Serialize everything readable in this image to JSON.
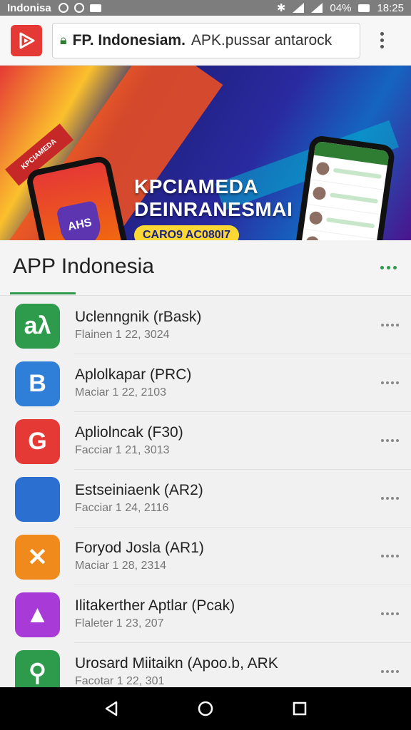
{
  "status_bar": {
    "carrier": "Indonisa",
    "battery": "04%",
    "time": "18:25"
  },
  "toolbar": {
    "url_domain": "FP. Indonesiam.",
    "url_path": "APK.pussar antarock"
  },
  "banner": {
    "title_line1": "KPCIAMEDA",
    "title_line2": "DEINRANESMAI",
    "cta": "CARO9 AC080I7",
    "ribbon": "KPCIAMEDA",
    "left_phone_badge": "AHS",
    "carousel_dots": [
      "#3949ab",
      "#fdd835",
      "#ffffff"
    ]
  },
  "section": {
    "title": "APP Indonesia"
  },
  "apps": [
    {
      "name": "Uclenngnik (rBask)",
      "meta": "Flainen 1 22, 3024",
      "icon": "aλ",
      "color": "#2e9a4c"
    },
    {
      "name": "Aplolkapar (PRC)",
      "meta": "Maciar 1 22, 2103",
      "icon": "B",
      "color": "#2f7fd8"
    },
    {
      "name": "Apliolncak (F30)",
      "meta": "Facciar 1 21, 3013",
      "icon": "G",
      "color": "#e53935"
    },
    {
      "name": "Estseiniaenk (AR2)",
      "meta": "Facciar 1 24, 2116",
      "icon": "",
      "color": "#2b6fd0"
    },
    {
      "name": "Foryod Josla (AR1)",
      "meta": "Maciar 1 28, 2314",
      "icon": "✕",
      "color": "#f08a1c"
    },
    {
      "name": "Ilitakerther Aptlar (Pcak)",
      "meta": "Flaleter 1 23, 207",
      "icon": "▲",
      "color": "#a83bd8"
    },
    {
      "name": "Urosard Miitaikn (Apoo.b, ARK",
      "meta": "Facotar 1 22, 301",
      "icon": "⚲",
      "color": "#2e9a4c"
    }
  ],
  "icons": {
    "app_logo": "play-icon",
    "back": "back-icon",
    "home": "home-icon",
    "recents": "recents-icon"
  }
}
